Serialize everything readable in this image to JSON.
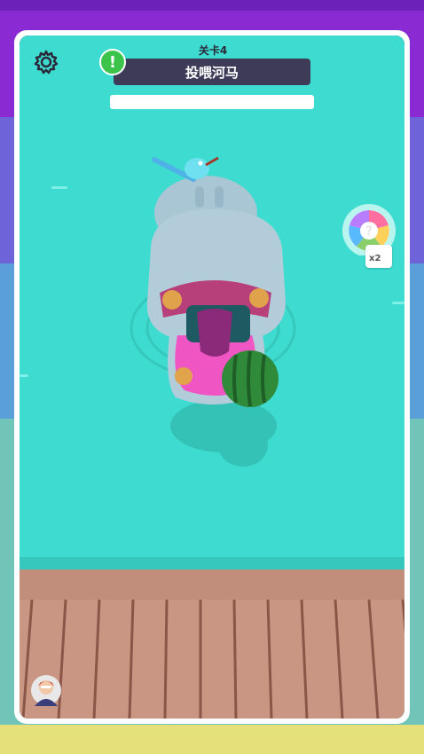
{
  "level": {
    "label": "关卡4"
  },
  "task": {
    "title": "投喂河马"
  },
  "progress": {
    "fraction": 0.0
  },
  "powerup": {
    "count_label": "x2",
    "icon": "mystery-ball-icon"
  },
  "colors": {
    "water": "#3edbd0",
    "dock": "#c08e7a",
    "task_bar": "#3d3b57",
    "badge": "#3bc34a",
    "bg_purple": "#8a2ad3",
    "bg_yellow": "#e6e07a"
  },
  "icons": {
    "settings": "gear-icon",
    "alert": "exclamation-icon",
    "avatar": "player-avatar-icon",
    "food": "watermelon-icon"
  }
}
